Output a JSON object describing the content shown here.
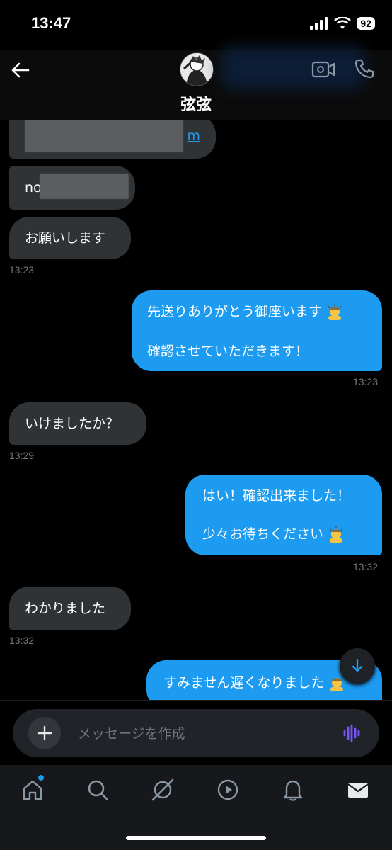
{
  "status": {
    "time": "13:47",
    "battery": "92"
  },
  "header": {
    "contact_name": "弦弦"
  },
  "messages": {
    "m1_link_suffix": "m",
    "m2_prefix": "no",
    "m3": "お願いします",
    "t1": "13:23",
    "m4_line1": "先送りありがとう御座います",
    "m4_line2": "確認させていただきます！",
    "t2": "13:23",
    "m5": "いけましたか？",
    "t3": "13:29",
    "m6_line1": "はい！確認出来ました！",
    "m6_line2": "少々お待ちください",
    "t4": "13:32",
    "m7": "わかりました",
    "t5": "13:32",
    "m8": "すみません遅くなりました"
  },
  "composer": {
    "placeholder": "メッセージを作成"
  },
  "icons": {
    "back": "arrow-left-icon",
    "video": "video-call-icon",
    "call": "phone-icon",
    "scroll": "arrow-down-icon",
    "plus": "plus-icon",
    "voice": "voice-wave-icon",
    "tabs": [
      "home-icon",
      "search-icon",
      "grok-icon",
      "video-play-icon",
      "bell-icon",
      "mail-icon"
    ],
    "emoji": "person-bowing-emoji"
  },
  "colors": {
    "accent": "#1d9bf0",
    "incoming": "#2f3336",
    "voice": "#7856ff"
  }
}
